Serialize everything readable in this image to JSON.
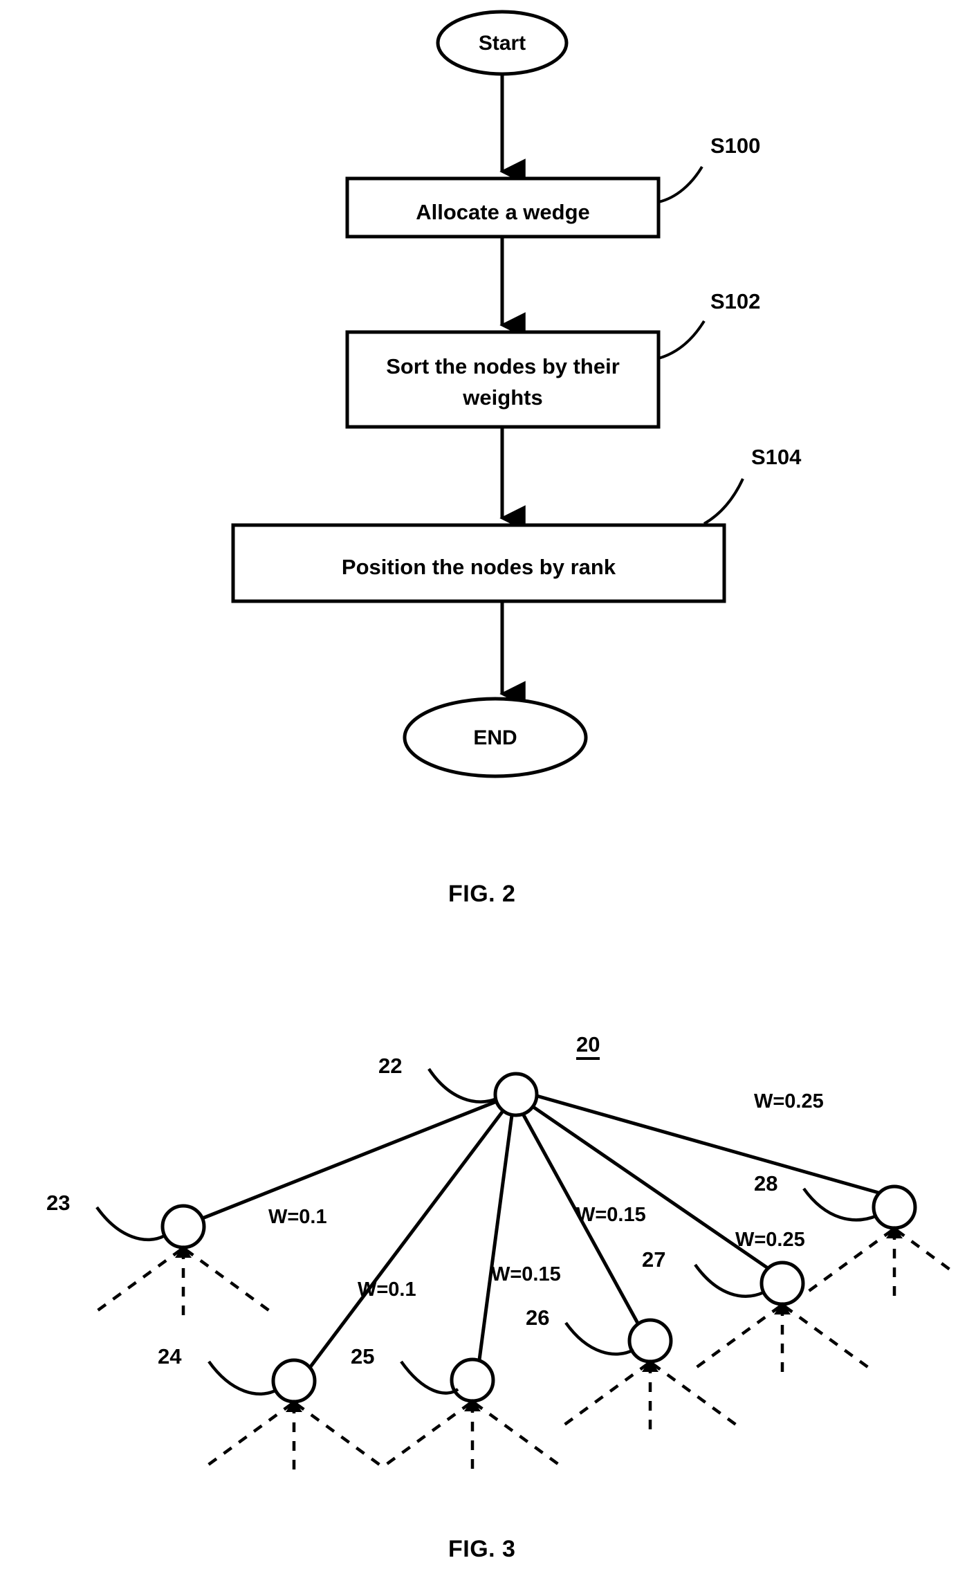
{
  "figures": [
    {
      "id": "fig2",
      "caption": "FIG. 2",
      "type": "flowchart",
      "nodes": [
        {
          "id": "start",
          "shape": "ellipse",
          "label": "Start"
        },
        {
          "id": "s100",
          "shape": "rect",
          "label": "Allocate a wedge",
          "ref": "S100"
        },
        {
          "id": "s102",
          "shape": "rect",
          "label": "Sort the nodes by their weights",
          "ref": "S102"
        },
        {
          "id": "s104",
          "shape": "rect",
          "label": "Position the nodes by rank",
          "ref": "S104"
        },
        {
          "id": "end",
          "shape": "ellipse",
          "label": "END"
        }
      ],
      "step_refs": [
        "S100",
        "S102",
        "S104"
      ]
    },
    {
      "id": "fig3",
      "caption": "FIG. 3",
      "type": "weighted-tree",
      "diagram_ref": "20",
      "root": {
        "ref": "22"
      },
      "children": [
        {
          "ref": "23",
          "weight_label": "W=0.1"
        },
        {
          "ref": "24",
          "weight_label": "W=0.1"
        },
        {
          "ref": "25",
          "weight_label": "W=0.15"
        },
        {
          "ref": "26",
          "weight_label": "W=0.15"
        },
        {
          "ref": "27",
          "weight_label": "W=0.25"
        },
        {
          "ref": "28",
          "weight_label": "W=0.25"
        }
      ],
      "weights": [
        "W=0.1",
        "W=0.1",
        "W=0.15",
        "W=0.15",
        "W=0.25",
        "W=0.25"
      ],
      "node_refs": [
        "20",
        "22",
        "23",
        "24",
        "25",
        "26",
        "27",
        "28"
      ]
    }
  ],
  "fig2": {
    "caption": "FIG. 2",
    "start_label": "Start",
    "box1_label": "Allocate a wedge",
    "box2_label": "Sort the nodes by their weights",
    "box3_label": "Position the nodes by rank",
    "end_label": "END",
    "ref1": "S100",
    "ref2": "S102",
    "ref3": "S104"
  },
  "fig3": {
    "caption": "FIG. 3",
    "ref_root_diagram": "20",
    "ref_22": "22",
    "ref_23": "23",
    "ref_24": "24",
    "ref_25": "25",
    "ref_26": "26",
    "ref_27": "27",
    "ref_28": "28",
    "w_23": "W=0.1",
    "w_24": "W=0.1",
    "w_25": "W=0.15",
    "w_26": "W=0.15",
    "w_27": "W=0.25",
    "w_28": "W=0.25"
  }
}
